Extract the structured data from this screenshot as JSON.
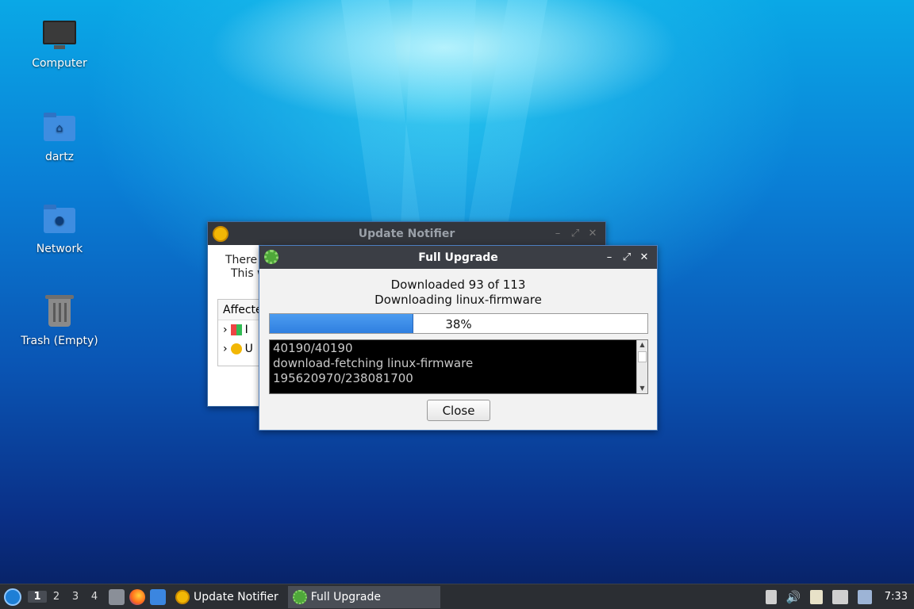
{
  "desktop": {
    "icons": [
      {
        "label": "Computer"
      },
      {
        "label": "dartz"
      },
      {
        "label": "Network"
      },
      {
        "label": "Trash (Empty)"
      }
    ]
  },
  "update_notifier_window": {
    "title": "Update Notifier",
    "body_line1": "There",
    "body_line2": "This w",
    "affected_header": "Affecte",
    "rows": [
      "I",
      "U"
    ]
  },
  "full_upgrade_window": {
    "title": "Full Upgrade",
    "status_line1": "Downloaded 93 of 113",
    "status_line2": "Downloading linux-firmware",
    "progress": {
      "value": 0.38,
      "label": "38%"
    },
    "log_lines": [
      "40190/40190",
      "download-fetching linux-firmware",
      "195620970/238081700"
    ],
    "close_label": "Close"
  },
  "taskbar": {
    "workspaces": [
      "1",
      "2",
      "3",
      "4"
    ],
    "active_workspace": "1",
    "tasks": [
      {
        "label": "Update Notifier"
      },
      {
        "label": "Full Upgrade"
      }
    ],
    "clock": "7:33"
  },
  "colors": {
    "accent": "#2f7fe0",
    "titlebar": "#3b3e45",
    "taskbar": "#2b2e33"
  }
}
